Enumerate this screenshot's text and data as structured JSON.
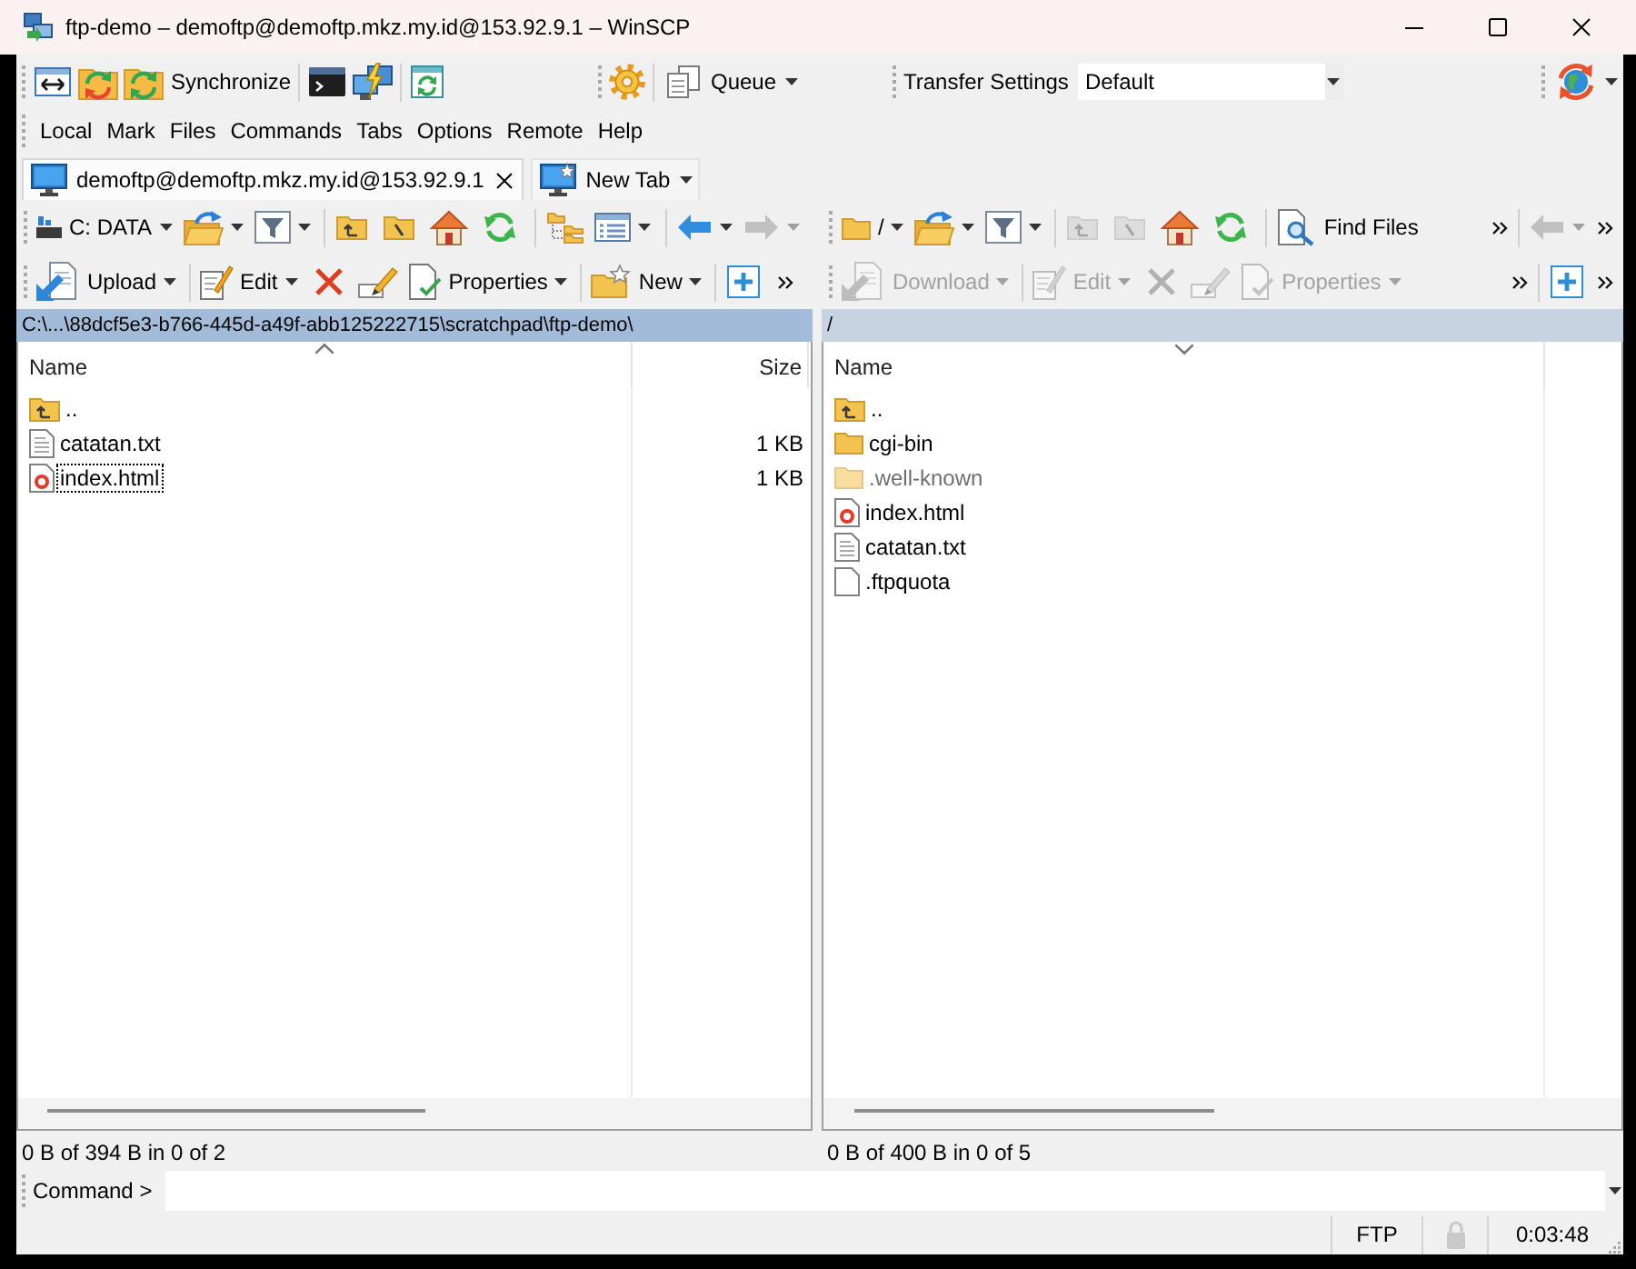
{
  "window": {
    "title": "ftp-demo – demoftp@demoftp.mkz.my.id@153.92.9.1 – WinSCP"
  },
  "toolbar": {
    "synchronize": "Synchronize",
    "queue": "Queue",
    "transfer_settings": {
      "label": "Transfer Settings",
      "value": "Default"
    }
  },
  "menu": [
    "Local",
    "Mark",
    "Files",
    "Commands",
    "Tabs",
    "Options",
    "Remote",
    "Help"
  ],
  "tabs": [
    {
      "label": "demoftp@demoftp.mkz.my.id@153.92.9.1",
      "kind": "session",
      "selected": true
    },
    {
      "label": "New Tab",
      "kind": "new",
      "selected": false
    }
  ],
  "panels": [
    {
      "kind": "local",
      "active": true,
      "location": "C: DATA",
      "path": "C:\\...\\88dcf5e3-b766-445d-a49f-abb125222715\\scratchpad\\ftp-demo\\",
      "navigation": [
        {
          "kind": "parent",
          "disabled": false
        },
        {
          "kind": "root",
          "disabled": false
        },
        {
          "kind": "home",
          "disabled": false
        },
        {
          "kind": "refresh",
          "disabled": false
        }
      ],
      "history": [
        {
          "kind": "back",
          "disabled": false
        },
        {
          "kind": "forward",
          "disabled": true
        }
      ],
      "actions": [
        {
          "kind": "upload",
          "label": "Upload",
          "disabled": false
        },
        {
          "kind": "edit",
          "label": "Edit",
          "disabled": false
        },
        {
          "kind": "delete",
          "disabled": false
        },
        {
          "kind": "rename",
          "disabled": false
        },
        {
          "kind": "properties",
          "label": "Properties",
          "disabled": false
        },
        {
          "kind": "new",
          "label": "New",
          "disabled": false
        }
      ],
      "columns": [
        {
          "label": "Name",
          "sorted": true,
          "descending": false
        },
        {
          "label": "Size",
          "sorted": false
        }
      ],
      "files": [
        {
          "name": "..",
          "kind": "parent",
          "hidden": false,
          "focused": false
        },
        {
          "name": "catatan.txt",
          "kind": "text",
          "size": "1 KB",
          "hidden": false,
          "focused": false
        },
        {
          "name": "index.html",
          "kind": "html",
          "size": "1 KB",
          "hidden": false,
          "focused": true
        }
      ],
      "summary": "0 B of 394 B in 0 of 2"
    },
    {
      "kind": "remote",
      "active": false,
      "location": "/",
      "find_files": "Find Files",
      "path": "/",
      "navigation": [
        {
          "kind": "parent",
          "disabled": true
        },
        {
          "kind": "root",
          "disabled": true
        },
        {
          "kind": "home",
          "disabled": false
        },
        {
          "kind": "refresh",
          "disabled": false
        }
      ],
      "history": [
        {
          "kind": "back",
          "disabled": true
        }
      ],
      "actions": [
        {
          "kind": "download",
          "label": "Download",
          "disabled": true
        },
        {
          "kind": "edit",
          "label": "Edit",
          "disabled": true
        },
        {
          "kind": "delete",
          "disabled": true
        },
        {
          "kind": "rename",
          "disabled": true
        },
        {
          "kind": "properties",
          "label": "Properties",
          "disabled": true
        }
      ],
      "columns": [
        {
          "label": "Name",
          "sorted": true,
          "descending": true
        }
      ],
      "files": [
        {
          "name": "..",
          "kind": "parent",
          "hidden": false,
          "focused": false
        },
        {
          "name": "cgi-bin",
          "kind": "folder",
          "hidden": false,
          "focused": false
        },
        {
          "name": ".well-known",
          "kind": "folder",
          "hidden": true,
          "focused": false
        },
        {
          "name": "index.html",
          "kind": "html",
          "hidden": false,
          "focused": false
        },
        {
          "name": "catatan.txt",
          "kind": "text",
          "hidden": false,
          "focused": false
        },
        {
          "name": ".ftpquota",
          "kind": "file",
          "hidden": false,
          "focused": false
        }
      ],
      "summary": "0 B of 400 B in 0 of 5"
    }
  ],
  "command_line": {
    "label": "Command >"
  },
  "status_bar": {
    "protocol": "FTP",
    "secure": false,
    "elapsed": "0:03:48"
  }
}
